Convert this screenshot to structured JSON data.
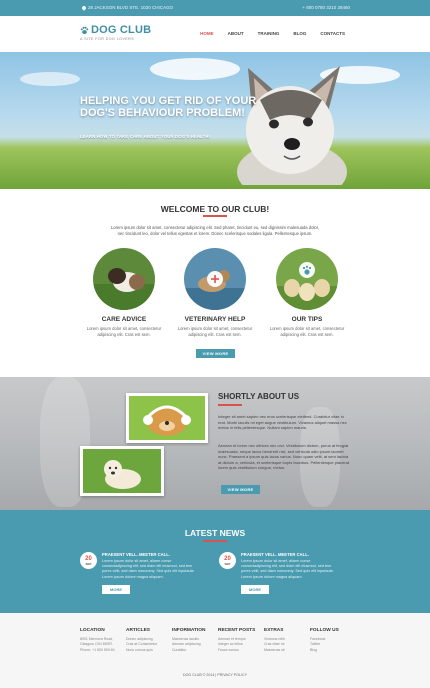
{
  "topbar": {
    "address": "28 JACKSON BLVD STE. 1020 CHICAGO",
    "phone": "+ 800 0780 3210 28460"
  },
  "header": {
    "logo_name": "DOG CLUB",
    "logo_tagline": "A SITE FOR DOG LOVERS",
    "nav": [
      "HOME",
      "ABOUT",
      "TRAINING",
      "BLOG",
      "CONTACTS"
    ],
    "nav_active": "HOME"
  },
  "hero": {
    "title": "HELPING YOU GET RID OF YOUR DOG'S BEHAVIOUR PROBLEM!",
    "subtitle": "LEARN HOW TO TAKE CARE ABOUT YOUR DOG'S HEALTH!"
  },
  "welcome": {
    "title": "WELCOME TO OUR CLUB!",
    "text": "Lorem ipsum dolor sit amet, consectetur adipiscing elit. Sed pharet, tincidunt eu, sed dignissim malesuada dolor, nec tincidunt leo, dolor vel tellus egestas et lorem. Donec scelerisque sodales ligula. Pellentesque ipsum.",
    "features": [
      {
        "title": "CARE ADVICE",
        "text": "Lorem ipsum dolor sit amet, consectetur adipiscing elit. Cras est sem."
      },
      {
        "title": "VETERINARY HELP",
        "text": "Lorem ipsum dolor sit amet, consectetur adipiscing elit. Cras est sem."
      },
      {
        "title": "OUR TIPS",
        "text": "Lorem ipsum dolor sit amet, consectetur adipiscing elit. Cras est sem."
      }
    ],
    "more_label": "VIEW MORE"
  },
  "about": {
    "title": "SHORTLY ABOUT US",
    "p1": "Integer sit amet sapien nec eros scelerisque eleifend. Curabitur vitae in erat. Morbi iaculis mi eget augue vestibulum. Vivamus aliquet massa nec metus in felis pellentesque. Nullam sapien mauris.",
    "p2": "Aenean et lorem nec ultrices nec orci. Vestibulum dictum, purus at feugiat malesuada, neque lacus hendrerit nisl, sed vehicula odio ipsum laoreet nunc. Praesent a ipsum quis lacus varius. Nunc quam velit, at sem lacinia at dictum a, vehicula, et scelerisque turpis faucibus. Pellentesque placerat, lorem quis vestibulum congue, metus.",
    "more_label": "VIEW MORE"
  },
  "news": {
    "title": "LATEST NEWS",
    "items": [
      {
        "day": "20",
        "month": "SEP",
        "title": "PRAESENT VELL. MEETER CALL.",
        "text": "Lorem ipsum dolor sit amet, aliarm conse consectadipiscing elit, sed diam elit eiusmod, sed tem porex velit, sed diam nonummy. Sed quis elit inputaute. Lorem ipsum dolore magna aliquam.",
        "button": "MORE"
      },
      {
        "day": "20",
        "month": "SEP",
        "title": "PRAESENT VELL. MEETER CALL.",
        "text": "Lorem ipsum dolor sit amet, aliarm conse consectadipiscing elit, sed diam elit eiusmod, sed tem porex velit, sed diam nonummy. Sed quis elit inputaute. Lorem ipsum dolore magna aliquam.",
        "button": "MORE"
      }
    ]
  },
  "footer": {
    "columns": [
      {
        "heading": "LOCATION",
        "lines": [
          "8901 Marmora Road,",
          "Glasgow, D04 89GR.",
          "Phone: +1 800 559 60"
        ]
      },
      {
        "heading": "ARTICLES",
        "lines": [
          "Donec adipiscing",
          "Cras at Consectetur",
          "Nunc cursus quis"
        ]
      },
      {
        "heading": "INFORMATION",
        "lines": [
          "Maecenas iaculis",
          "Aenean adipiscing",
          "Curabitur"
        ]
      },
      {
        "heading": "RECENT POSTS",
        "lines": [
          "Aenean et tempor",
          "Integer ac tellus",
          "Fusce cursus"
        ]
      },
      {
        "heading": "EXTRAS",
        "lines": [
          "Vivamus nibh",
          "Cras vitae mi",
          "Maecenas sit"
        ]
      },
      {
        "heading": "FOLLOW US",
        "lines": [
          "Facebook",
          "Twitter",
          "Blog"
        ]
      }
    ],
    "copyright": "DOG CLUB © 2014  |  PRIVACY POLICY"
  },
  "colors": {
    "primary": "#4a9bb0",
    "accent": "#d9534f"
  }
}
